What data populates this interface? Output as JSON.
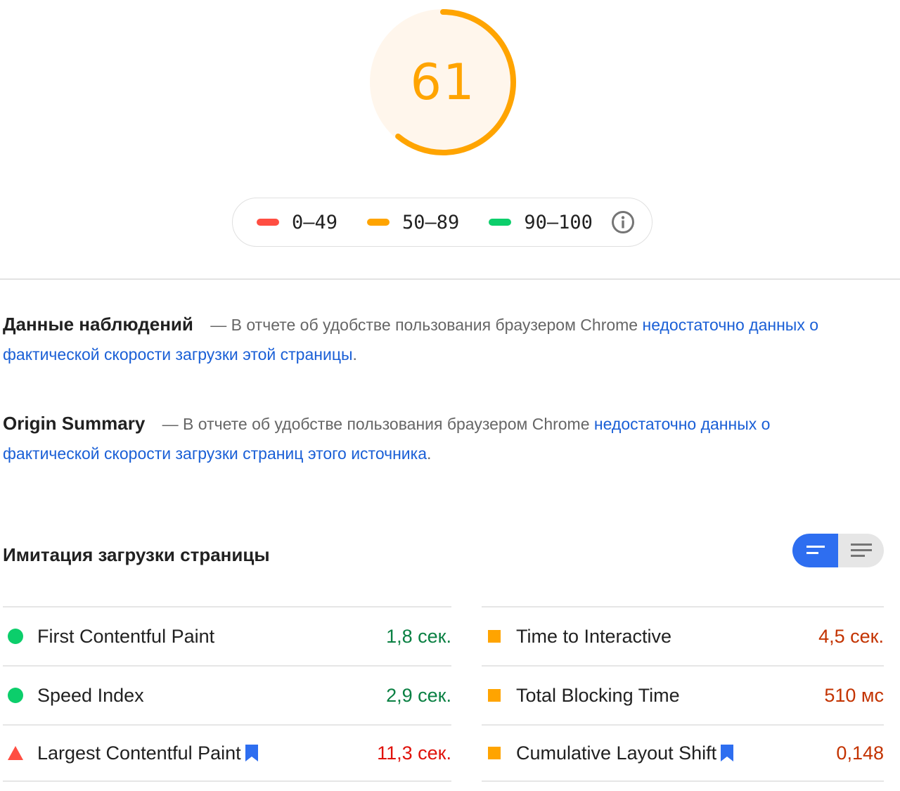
{
  "score": {
    "value": "61",
    "fraction": 0.61,
    "color": "#ffa400",
    "bg_color": "#fff6ec"
  },
  "legend": [
    {
      "range": "0–49",
      "color": "#ff4e42"
    },
    {
      "range": "50–89",
      "color": "#ffa400"
    },
    {
      "range": "90–100",
      "color": "#0cce6b"
    }
  ],
  "field_data": {
    "title": "Данные наблюдений",
    "dash_text": "— В отчете об удобстве пользования браузером Chrome",
    "link_text": "недостаточно данных о фактической скорости загрузки этой страницы",
    "end": "."
  },
  "origin_summary": {
    "title": "Origin Summary",
    "dash_text": "— В отчете об удобстве пользования браузером Chrome",
    "link_text": "недостаточно данных о фактической скорости загрузки страниц этого источника",
    "end": "."
  },
  "lab": {
    "title": "Имитация загрузки страницы"
  },
  "metrics_left": [
    {
      "name": "First Contentful Paint",
      "value": "1,8 сек.",
      "rating": "good"
    },
    {
      "name": "Speed Index",
      "value": "2,9 сек.",
      "rating": "good"
    },
    {
      "name": "Largest Contentful Paint",
      "value": "11,3 сек.",
      "rating": "poor"
    }
  ],
  "metrics_right": [
    {
      "name": "Time to Interactive",
      "value": "4,5 сек.",
      "rating": "average"
    },
    {
      "name": "Total Blocking Time",
      "value": "510 мс",
      "rating": "average"
    },
    {
      "name": "Cumulative Layout Shift",
      "value": "0,148",
      "rating": "average"
    }
  ],
  "colors": {
    "link": "#1a5fd6",
    "toggle_active": "#2e6ef0",
    "bookmark": "#2e6ef0"
  }
}
